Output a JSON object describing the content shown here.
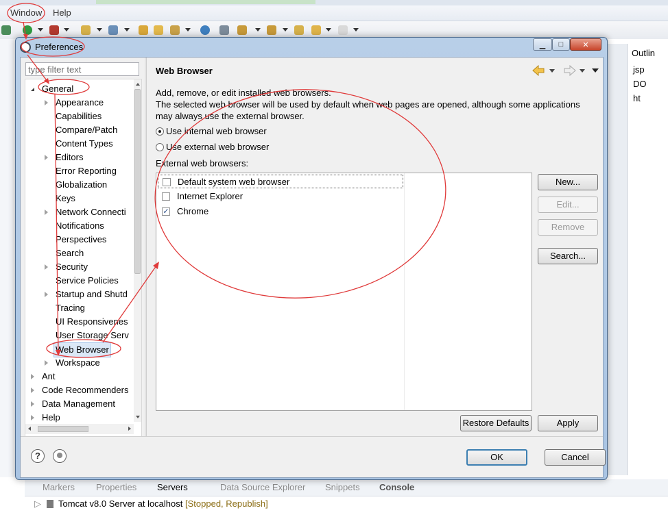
{
  "ide": {
    "menu": [
      "Window",
      "Help"
    ],
    "outline": {
      "title": "Outlin",
      "rows": [
        "jsp",
        "DO",
        "ht"
      ]
    },
    "bottom_tabs": {
      "markers": "Markers",
      "properties": "Properties",
      "servers": "Servers",
      "data_source_explorer": "Data Source Explorer",
      "snippets": "Snippets",
      "console": "Console"
    },
    "server_row": {
      "name": "Tomcat v8.0 Server at localhost",
      "status": "[Stopped, Republish]"
    }
  },
  "dialog": {
    "title": "Preferences",
    "filter_placeholder": "type filter text",
    "tree": [
      {
        "label": "General",
        "expander": "open"
      },
      {
        "label": "Appearance",
        "expander": "closed"
      },
      {
        "label": "Capabilities",
        "expander": "none"
      },
      {
        "label": "Compare/Patch",
        "expander": "none"
      },
      {
        "label": "Content Types",
        "expander": "none"
      },
      {
        "label": "Editors",
        "expander": "closed"
      },
      {
        "label": "Error Reporting",
        "expander": "none"
      },
      {
        "label": "Globalization",
        "expander": "none"
      },
      {
        "label": "Keys",
        "expander": "none"
      },
      {
        "label": "Network Connecti",
        "expander": "closed"
      },
      {
        "label": "Notifications",
        "expander": "none"
      },
      {
        "label": "Perspectives",
        "expander": "none"
      },
      {
        "label": "Search",
        "expander": "none"
      },
      {
        "label": "Security",
        "expander": "closed"
      },
      {
        "label": "Service Policies",
        "expander": "none"
      },
      {
        "label": "Startup and Shutd",
        "expander": "closed"
      },
      {
        "label": "Tracing",
        "expander": "none"
      },
      {
        "label": "UI Responsivenes",
        "expander": "none"
      },
      {
        "label": "User Storage Serv",
        "expander": "none"
      },
      {
        "label": "Web Browser",
        "expander": "none",
        "selected": true
      },
      {
        "label": "Workspace",
        "expander": "closed"
      },
      {
        "label": "Ant",
        "expander": "closed"
      },
      {
        "label": "Code Recommenders",
        "expander": "closed"
      },
      {
        "label": "Data Management",
        "expander": "closed"
      },
      {
        "label": "Help",
        "expander": "closed"
      }
    ],
    "page": {
      "heading": "Web Browser",
      "description": "Add, remove, or edit installed web browsers.\nThe selected web browser will be used by default when web pages are opened, although some applications may always use the external browser.",
      "radio_internal": "Use internal web browser",
      "radio_external": "Use external web browser",
      "selected_radio": "internal",
      "external_label": "External web browsers:",
      "browsers": [
        {
          "name": "Default system web browser",
          "checked": false
        },
        {
          "name": "Internet Explorer",
          "checked": false
        },
        {
          "name": "Chrome",
          "checked": true
        }
      ],
      "buttons": {
        "new": "New...",
        "edit": "Edit...",
        "remove": "Remove",
        "search": "Search...",
        "restore_defaults": "Restore Defaults",
        "apply": "Apply"
      }
    },
    "footer": {
      "ok": "OK",
      "cancel": "Cancel",
      "help_glyph": "?"
    }
  },
  "colors": {
    "annotation_red": "#e03b3b",
    "selection_bg": "#dbe8f7",
    "dialog_frame": "#a9c4e3"
  }
}
